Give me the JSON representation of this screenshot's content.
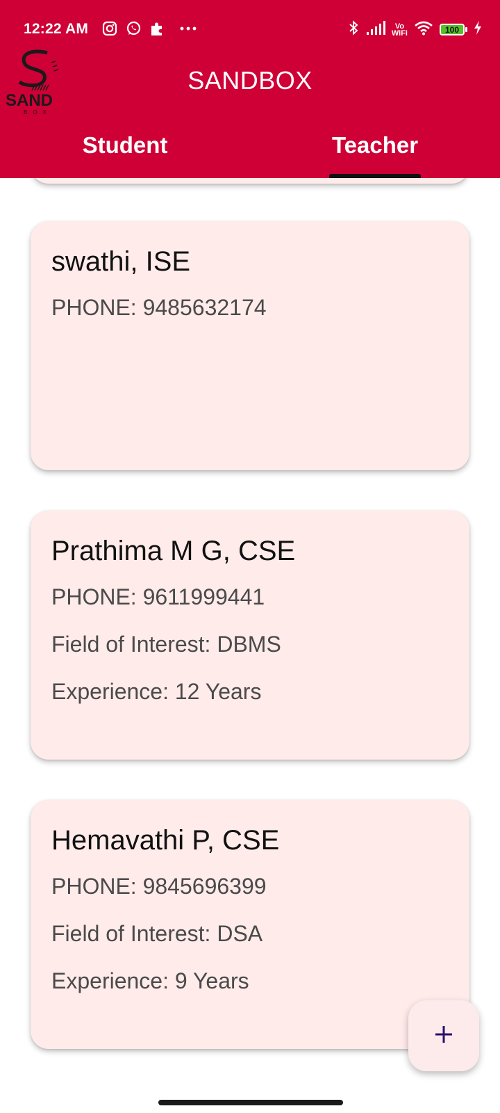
{
  "status_bar": {
    "time": "12:22 AM",
    "left_icons": [
      "instagram-icon",
      "whatsapp-icon",
      "puzzle-icon",
      "more-dots-icon"
    ],
    "right_icons": [
      "bluetooth-icon",
      "signal-icon",
      "vowifi-icon",
      "wifi-icon",
      "battery-icon",
      "charging-icon"
    ],
    "vowifi_line1": "Vo",
    "vowifi_line2": "WiFi",
    "battery_level": "100"
  },
  "header": {
    "logo_text": "SAND",
    "logo_subtext": "BOX",
    "title": "SANDBOX",
    "background_color": "#cf0036"
  },
  "tabs": [
    {
      "label": "Student",
      "selected": false
    },
    {
      "label": "Teacher",
      "selected": true
    }
  ],
  "cards": [
    {
      "title": "swathi, ISE",
      "lines": [
        "PHONE: 9485632174"
      ]
    },
    {
      "title": "Prathima M G, CSE",
      "lines": [
        "PHONE: 9611999441",
        "Field of Interest: DBMS",
        "Experience: 12 Years"
      ]
    },
    {
      "title": "Hemavathi P, CSE",
      "lines": [
        "PHONE: 9845696399",
        "Field of Interest: DSA",
        "Experience: 9 Years"
      ]
    }
  ],
  "fab": {
    "icon": "plus-icon"
  },
  "colors": {
    "accent": "#cf0036",
    "card_background": "#ffebea",
    "fab_icon": "#2a0f6e"
  }
}
